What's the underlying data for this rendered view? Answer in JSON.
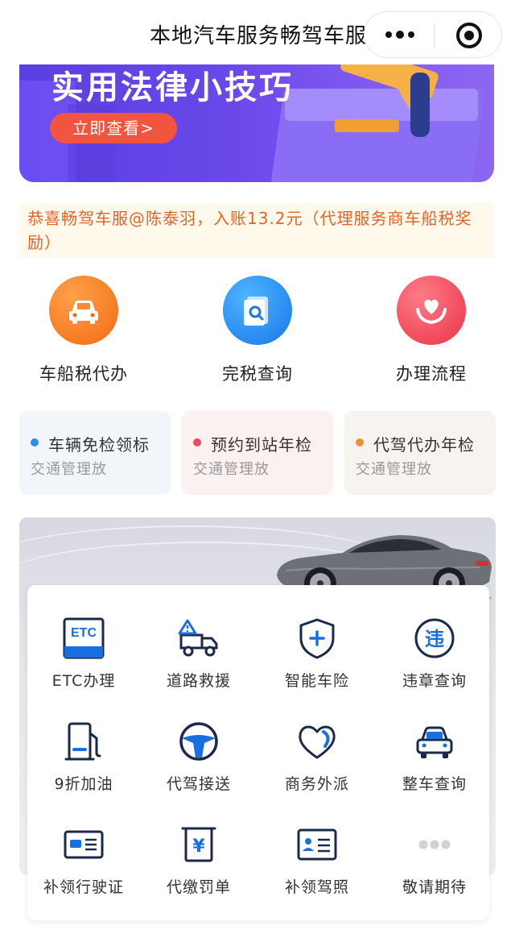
{
  "window": {
    "title": "本地汽车服务畅驾车服"
  },
  "banner": {
    "title": "实用法律小技巧",
    "button_label": "立即查看>"
  },
  "notice": {
    "text": "恭喜畅驾车服@陈泰羽，入账13.2元（代理服务商车船税奖励）"
  },
  "main_services": [
    {
      "label": "车船税代办",
      "icon": "car-icon",
      "color": "#f26b12"
    },
    {
      "label": "完税查询",
      "icon": "document-search-icon",
      "color": "#1877e8"
    },
    {
      "label": "办理流程",
      "icon": "heart-hands-icon",
      "color": "#ea3345"
    }
  ],
  "quick_cards": [
    {
      "title": "车辆免检领标",
      "subtitle": "交通管理放",
      "dot_color": "#2f8de8",
      "bg": "#f2f6fa"
    },
    {
      "title": "预约到站年检",
      "subtitle": "交通管理放",
      "dot_color": "#f04860",
      "bg": "#fbf1f1"
    },
    {
      "title": "代驾代办年检",
      "subtitle": "交通管理放",
      "dot_color": "#f09030",
      "bg": "#f7f3ef"
    }
  ],
  "grid_services": [
    {
      "label": "ETC办理",
      "icon": "etc-icon",
      "icon_text": "ETC"
    },
    {
      "label": "道路救援",
      "icon": "tow-truck-icon"
    },
    {
      "label": "智能车险",
      "icon": "shield-plus-icon"
    },
    {
      "label": "违章查询",
      "icon": "violation-icon",
      "icon_text": "违"
    },
    {
      "label": "9折加油",
      "icon": "fuel-pump-icon"
    },
    {
      "label": "代驾接送",
      "icon": "steering-wheel-icon"
    },
    {
      "label": "商务外派",
      "icon": "heart-icon"
    },
    {
      "label": "整车查询",
      "icon": "car-icon"
    },
    {
      "label": "补领行驶证",
      "icon": "vehicle-license-icon"
    },
    {
      "label": "代缴罚单",
      "icon": "ticket-yuan-icon",
      "icon_text": "¥"
    },
    {
      "label": "补领驾照",
      "icon": "driver-license-icon"
    },
    {
      "label": "敬请期待",
      "icon": "more-dots-icon"
    }
  ],
  "colors": {
    "accent_blue": "#1a6fe0",
    "icon_dark": "#1b2a4a",
    "notice_text": "#e0662a",
    "banner_button": "#f2553f"
  }
}
